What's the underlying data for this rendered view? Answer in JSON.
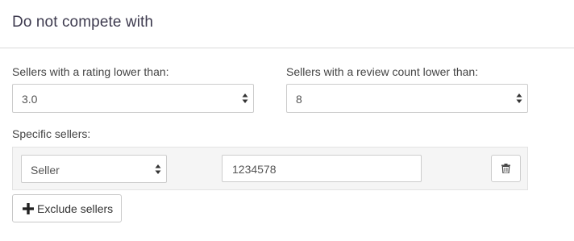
{
  "panel": {
    "title": "Do not compete with"
  },
  "rating_filter": {
    "label": "Sellers with a rating lower than:",
    "value": "3.0"
  },
  "review_filter": {
    "label": "Sellers with a review count lower than:",
    "value": "8"
  },
  "specific_sellers": {
    "label": "Specific sellers:",
    "rows": [
      {
        "type_value": "Seller",
        "id_value": "1234578",
        "delete_icon": "trash-icon"
      }
    ],
    "add_button_label": "Exclude sellers",
    "add_button_icon": "plus-icon"
  }
}
